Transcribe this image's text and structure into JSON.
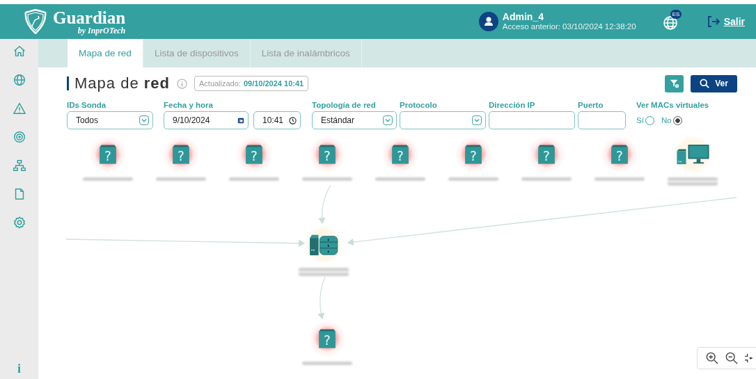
{
  "header": {
    "brand": "Guardian",
    "brand_sub": "by InprOTech",
    "user": {
      "name": "Admin_4",
      "last_access": "Acceso anterior: 03/10/2024 12:38:20"
    },
    "language": "ES",
    "logout": "Salir"
  },
  "sidebar": {
    "items": [
      {
        "kind": "home",
        "selected": false
      },
      {
        "kind": "globe",
        "selected": false
      },
      {
        "kind": "warning",
        "selected": false
      },
      {
        "kind": "radar",
        "selected": false
      },
      {
        "kind": "network",
        "selected": false
      },
      {
        "kind": "document",
        "selected": false
      },
      {
        "kind": "settings",
        "selected": false
      }
    ],
    "info": "i"
  },
  "tabs": [
    {
      "label": "Mapa de red",
      "selected": true
    },
    {
      "label": "Lista de dispositivos",
      "selected": false
    },
    {
      "label": "Lista de inalámbricos",
      "selected": false
    }
  ],
  "page": {
    "title": "Mapa de **red**",
    "updated_label": "Actualizado:",
    "updated_value": "09/10/2024 10:41",
    "view_button": "Ver"
  },
  "filters": [
    {
      "kind": "select",
      "label": "IDs Sonda",
      "value": "Todos"
    },
    {
      "kind": "datetime",
      "label": "Fecha y hora",
      "value": "9/10/2024",
      "time": "10:41"
    },
    {
      "kind": "select",
      "label": "Topología de red",
      "value": "Estándar"
    },
    {
      "kind": "select",
      "label": "Protocolo"
    },
    {
      "kind": "text",
      "label": "Dirección IP"
    },
    {
      "kind": "text",
      "label": "Puerto"
    },
    {
      "kind": "radio",
      "label": "Ver MACs virtuales",
      "options": [
        {
          "label": "Sí",
          "selected": false
        },
        {
          "label": "No",
          "selected": true
        }
      ]
    }
  ],
  "map": {
    "top_row": [
      {
        "kind": "unknown",
        "glyph": "?",
        "alert": true
      },
      {
        "kind": "unknown",
        "glyph": "?",
        "alert": true
      },
      {
        "kind": "unknown",
        "glyph": "?",
        "alert": true
      },
      {
        "kind": "unknown",
        "glyph": "?",
        "alert": true
      },
      {
        "kind": "unknown",
        "glyph": "?",
        "alert": true
      },
      {
        "kind": "unknown",
        "glyph": "?",
        "alert": true
      },
      {
        "kind": "unknown",
        "glyph": "?",
        "alert": true
      },
      {
        "kind": "unknown",
        "glyph": "?",
        "alert": true
      },
      {
        "kind": "computer",
        "alert": false
      }
    ],
    "hub": {
      "kind": "server",
      "alert": false
    },
    "below": [
      {
        "kind": "unknown",
        "glyph": "?",
        "alert": true
      }
    ]
  }
}
